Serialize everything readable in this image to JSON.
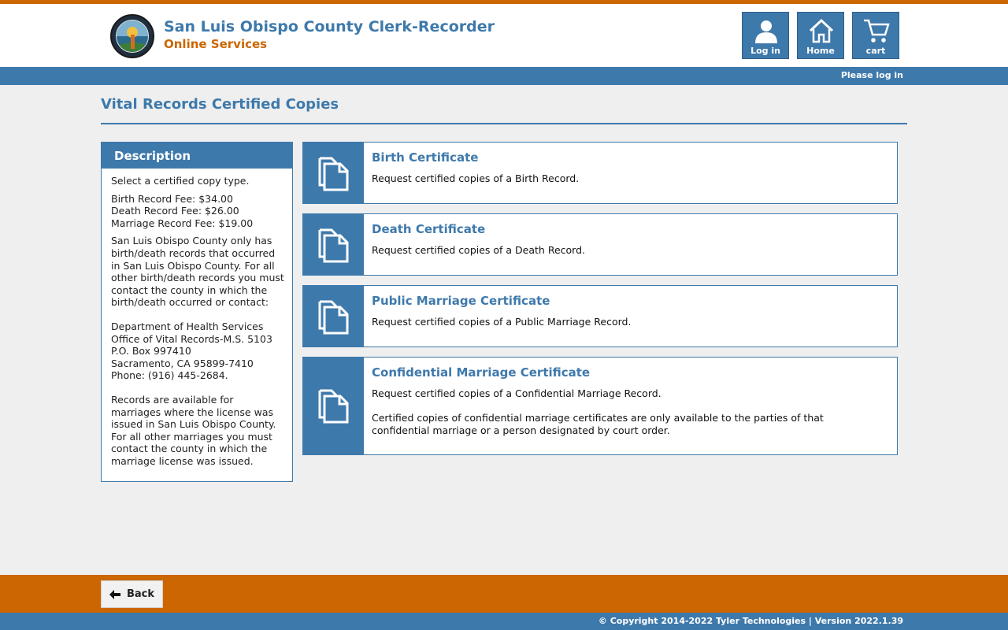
{
  "header": {
    "title": "San Luis Obispo County Clerk-Recorder",
    "subtitle": "Online Services",
    "buttons": {
      "login": "Log in",
      "home": "Home",
      "cart": "cart"
    }
  },
  "status_bar": {
    "login_prompt": "Please log in"
  },
  "page": {
    "title": "Vital Records Certified Copies"
  },
  "description": {
    "heading": "Description",
    "intro": "Select a certified copy type.",
    "fees": [
      "Birth Record Fee: $34.00",
      "Death Record Fee: $26.00",
      "Marriage Record Fee: $19.00"
    ],
    "birth_death_note": "San Luis Obispo County only has birth/death records that occurred in San Luis Obispo County. For all other birth/death records you must contact the county in which the birth/death occurred or contact:",
    "address": [
      "Department of Health Services",
      "Office of Vital Records-M.S. 5103",
      "P.O. Box 997410",
      "Sacramento, CA 95899-7410",
      "Phone: (916) 445-2684."
    ],
    "marriage_note": "Records are available for marriages where the license was issued in San Luis Obispo County. For all other marriages you must contact the county in which the marriage license was issued."
  },
  "cards": [
    {
      "title": "Birth Certificate",
      "description": "Request certified copies of a Birth Record."
    },
    {
      "title": "Death Certificate",
      "description": "Request certified copies of a Death Record."
    },
    {
      "title": "Public Marriage Certificate",
      "description": "Request certified copies of a Public Marriage Record."
    },
    {
      "title": "Confidential Marriage Certificate",
      "description": "Request certified copies of a Confidential Marriage Record.",
      "note": "Certified copies of confidential marriage certificates are only available to the parties of that confidential marriage or a person designated by court order."
    }
  ],
  "footer": {
    "back_label": "Back",
    "copyright": "© Copyright 2014-2022 Tyler Technologies | Version 2022.1.39"
  },
  "colors": {
    "brand_blue": "#3e79ab",
    "brand_orange": "#cc6600"
  },
  "icons": {
    "card": "document-copy-icon",
    "login": "user-icon",
    "home": "home-icon",
    "cart": "cart-icon",
    "back": "arrow-left-icon"
  }
}
